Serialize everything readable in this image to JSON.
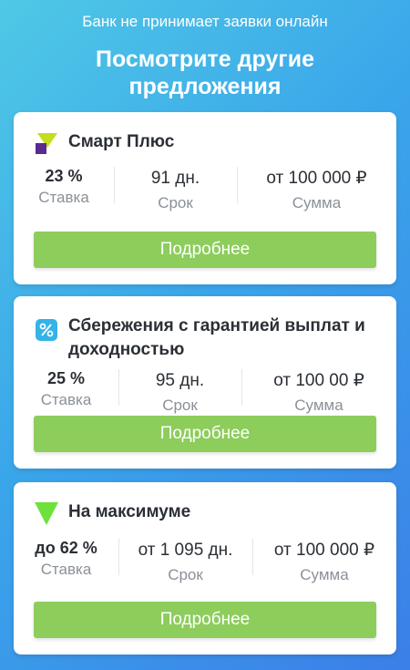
{
  "notice": "Банк не принимает заявки онлайн",
  "headline": "Посмотрите другие предложения",
  "colors": {
    "accent_button": "#8dcd5c",
    "background_from": "#4fc8e6",
    "background_to": "#3b7fe8"
  },
  "offers": [
    {
      "icon": "smart-plus-logo-icon",
      "title": "Смарт Плюс",
      "rate": "23 %",
      "rate_label": "Ставка",
      "term": "91 дн.",
      "term_label": "Срок",
      "amount": "от 100 000 ₽",
      "amount_label": "Сумма",
      "button": "Подробнее"
    },
    {
      "icon": "percent-savings-icon",
      "title": "Сбережения с гарантией выплат и доходностью",
      "rate": "25 %",
      "rate_label": "Ставка",
      "term": "95 дн.",
      "term_label": "Срок",
      "amount": "от 100 00 ₽",
      "amount_label": "Сумма",
      "button": "Подробнее"
    },
    {
      "icon": "green-triangle-logo-icon",
      "title": "На максимуме",
      "rate": "до 62 %",
      "rate_label": "Ставка",
      "term": "от 1 095 дн.",
      "term_label": "Срок",
      "amount": "от 100 000 ₽",
      "amount_label": "Сумма",
      "button": "Подробнее"
    }
  ]
}
